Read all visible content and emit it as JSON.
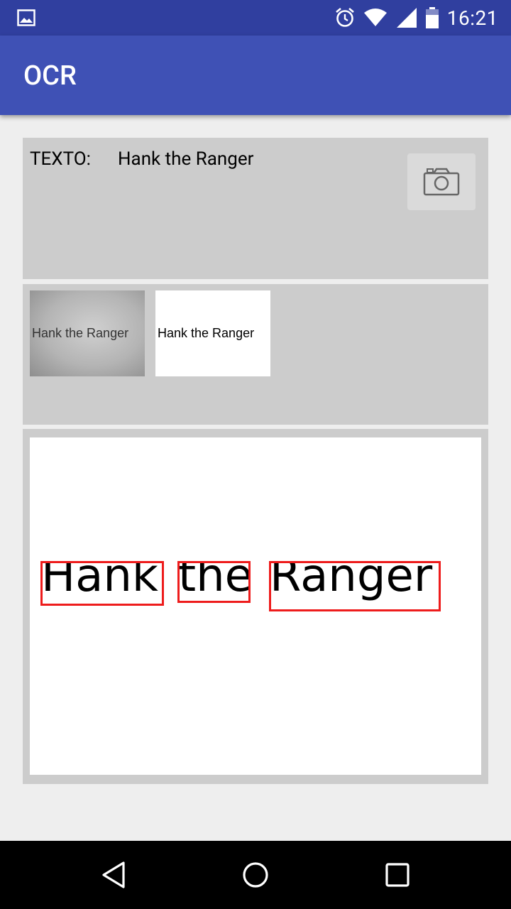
{
  "status_bar": {
    "time": "16:21",
    "icons": [
      "gallery-notification-icon",
      "alarm-icon",
      "wifi-icon",
      "cell-signal-icon",
      "battery-icon"
    ]
  },
  "app_bar": {
    "title": "OCR"
  },
  "text_panel": {
    "label": "TEXTO:",
    "value": "Hank the Ranger",
    "camera_icon": "camera-icon"
  },
  "thumbnails": {
    "original_text": "Hank the Ranger",
    "processed_text": "Hank the Ranger"
  },
  "result": {
    "words": [
      "Hank",
      "the",
      "Ranger"
    ],
    "box_color": "#ee1c1c"
  },
  "nav_bar": {
    "icons": [
      "back-icon",
      "home-icon",
      "recents-icon"
    ]
  },
  "colors": {
    "primary": "#3f51b5",
    "primary_dark": "#303f9f",
    "panel": "#cccccc"
  }
}
